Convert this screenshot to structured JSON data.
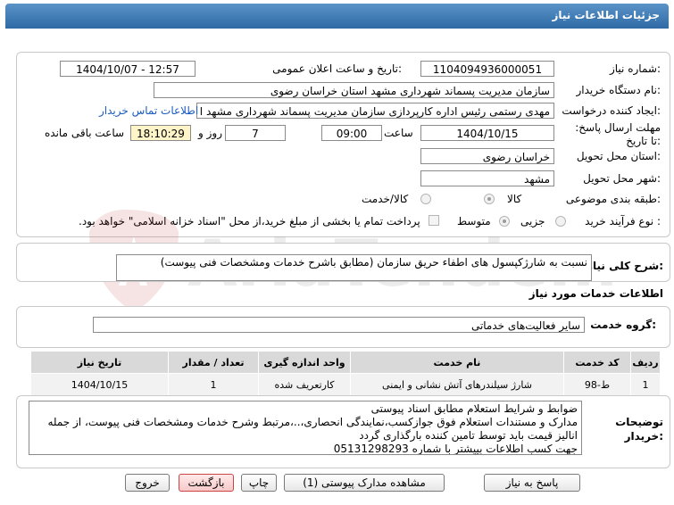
{
  "header": {
    "title": "جزئیات اطلاعات نیاز"
  },
  "labels": {
    "need_number": "شماره نیاز:",
    "announce_datetime": "تاریخ و ساعت اعلان عمومی:",
    "buyer_org": "نام دستگاه خریدار:",
    "request_creator": "ایجاد کننده درخواست:",
    "contact_link": "اطلاعات تماس خریدار",
    "reply_deadline": "مهلت ارسال پاسخ: تا تاریخ:",
    "time": "ساعت",
    "day_and": "روز و",
    "remaining": "ساعت باقی مانده",
    "delivery_province": "استان محل تحویل:",
    "delivery_city": "شهر محل تحویل:",
    "category": "طبقه بندی موضوعی:",
    "purchase_type": "نوع فرآیند خرید :",
    "need_summary": "شرح کلی نیاز:",
    "services_info": "اطلاعات خدمات مورد نیاز",
    "service_group": "گروه خدمت:",
    "buyer_notes": "توضیحات خریدار:"
  },
  "fields": {
    "need_number": "1104094936000051",
    "announce_datetime": "1404/10/07 - 12:57",
    "buyer_org": "سازمان مدیریت پسماند شهرداری مشهد استان خراسان رضوی",
    "request_creator": "مهدی رستمی رئیس اداره کارپردازی سازمان مدیریت پسماند شهرداری مشهد ا",
    "reply_date": "1404/10/15",
    "reply_time": "09:00",
    "days": "7",
    "remaining_time": "18:10:29",
    "delivery_province": "خراسان رضوی",
    "delivery_city": "مشهد",
    "need_summary": "نسبت به شارژکپسول های اطفاء حریق سازمان (مطابق باشرح خدمات ومشخصات فنی پیوست)",
    "service_group": "سایر فعالیت‌های خدماتی"
  },
  "category_options": [
    {
      "label": "کالا",
      "selected": true
    },
    {
      "label": "کالا/خدمت",
      "selected": false
    }
  ],
  "purchase_options": [
    {
      "label": "جزیی",
      "selected": false
    },
    {
      "label": "متوسط",
      "selected": true
    }
  ],
  "payment_note": "پرداخت تمام یا بخشی از مبلغ خرید،از محل \"اسناد خزانه اسلامی\" خواهد بود.",
  "table": {
    "headers": [
      "ردیف",
      "کد خدمت",
      "نام خدمت",
      "واحد اندازه گیری",
      "تعداد / مقدار",
      "تاریخ نیاز"
    ],
    "rows": [
      [
        "1",
        "ط-98",
        "شارژ سیلندرهای آتش نشانی و ایمنی",
        "کارتعریف شده",
        "1",
        "1404/10/15"
      ]
    ]
  },
  "notes": [
    "ضوابط و شرایط استعلام مطابق اسناد پیوستی",
    "مدارک و مستندات استعلام فوق جوازکسب،نمایندگی انحصاری،..،مرتبط وشرح خدمات ومشخصات فنی پیوست، از جمله",
    "انالیز قیمت باید توسط تامین کننده بارگذاری گردد",
    "جهت کسب اطلاعات بییشتر با شماره 05131298293"
  ],
  "buttons": {
    "reply": "پاسخ به نیاز",
    "view_attachments": "مشاهده مدارک پیوستی (1)",
    "print": "چاپ",
    "back": "بازگشت",
    "exit": "خروج"
  },
  "watermark": {
    "text": "AriaTender.net"
  }
}
